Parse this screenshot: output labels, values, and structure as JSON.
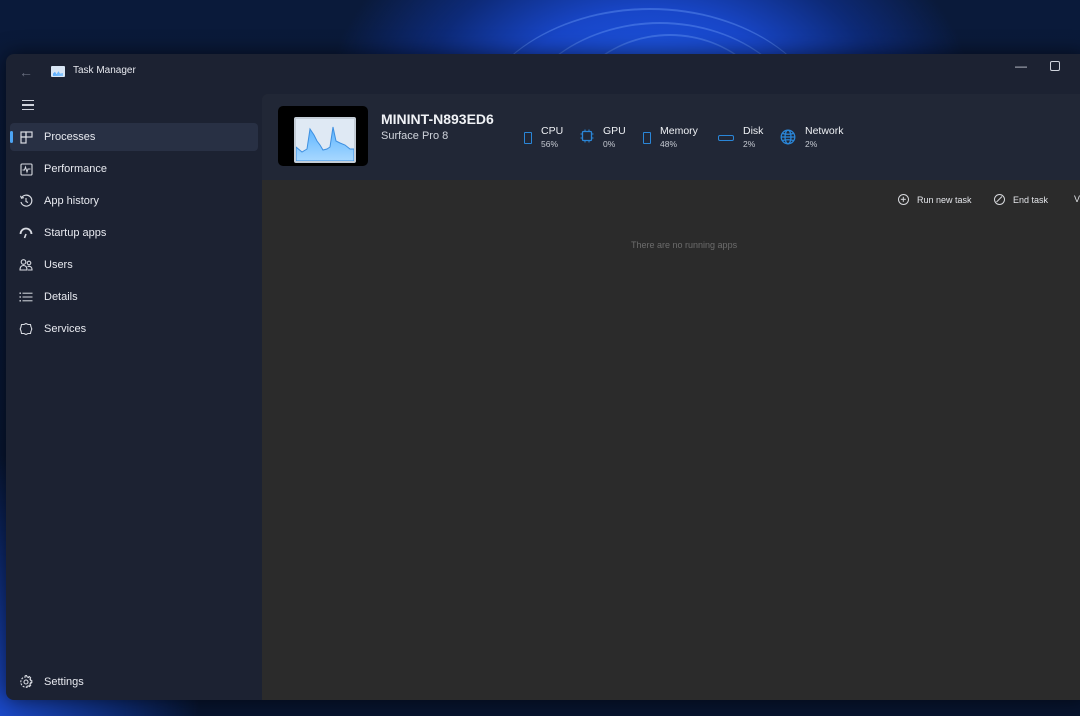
{
  "window": {
    "app_title": "Task Manager",
    "controls": {
      "minimize": "minimize",
      "maximize": "maximize"
    }
  },
  "sidebar": {
    "menu_icon": "hamburger-icon",
    "items": [
      {
        "label": "Processes",
        "icon": "processes-icon",
        "active": true
      },
      {
        "label": "Performance",
        "icon": "performance-icon",
        "active": false
      },
      {
        "label": "App history",
        "icon": "history-icon",
        "active": false
      },
      {
        "label": "Startup apps",
        "icon": "speedometer-icon",
        "active": false
      },
      {
        "label": "Users",
        "icon": "users-icon",
        "active": false
      },
      {
        "label": "Details",
        "icon": "list-icon",
        "active": false
      },
      {
        "label": "Services",
        "icon": "services-icon",
        "active": false
      }
    ],
    "settings": {
      "label": "Settings",
      "icon": "gear-icon"
    }
  },
  "header": {
    "device_name": "MININT-N893ED6",
    "device_model": "Surface Pro 8",
    "metrics": [
      {
        "name": "CPU",
        "value": "56%",
        "icon": "cpu-icon"
      },
      {
        "name": "GPU",
        "value": "0%",
        "icon": "gpu-icon"
      },
      {
        "name": "Memory",
        "value": "48%",
        "icon": "memory-icon"
      },
      {
        "name": "Disk",
        "value": "2%",
        "icon": "disk-icon"
      },
      {
        "name": "Network",
        "value": "2%",
        "icon": "globe-icon"
      }
    ],
    "accent_color": "#2a86d8"
  },
  "toolbar": {
    "run_new_task": "Run new task",
    "end_task": "End task",
    "overflow_partial": "V"
  },
  "content": {
    "empty_message": "There are no running apps"
  }
}
